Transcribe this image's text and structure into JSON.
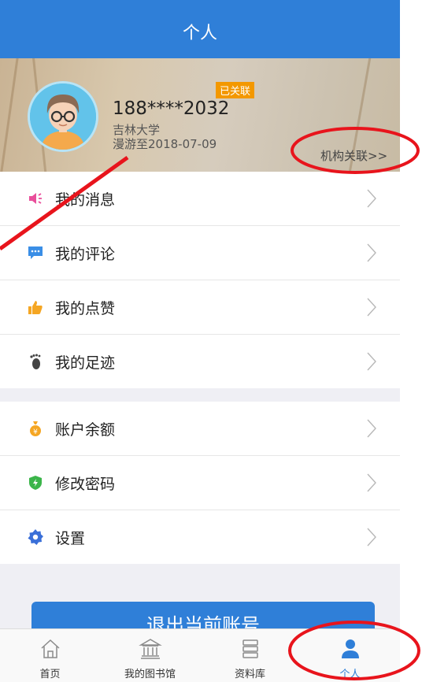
{
  "header": {
    "title": "个人"
  },
  "profile": {
    "phone": "188****2032",
    "school": "吉林大学",
    "roam": "漫游至2018-07-09",
    "badge": "已关联",
    "org_link": "机构关联>>"
  },
  "menu": {
    "group1": [
      {
        "label": "我的消息",
        "icon": "speaker-icon",
        "color": "#e94f9b"
      },
      {
        "label": "我的评论",
        "icon": "comment-icon",
        "color": "#3a8ee6"
      },
      {
        "label": "我的点赞",
        "icon": "thumbs-up-icon",
        "color": "#f5a623"
      },
      {
        "label": "我的足迹",
        "icon": "footprint-icon",
        "color": "#444444"
      }
    ],
    "group2": [
      {
        "label": "账户余额",
        "icon": "money-bag-icon",
        "color": "#f5a623"
      },
      {
        "label": "修改密码",
        "icon": "shield-icon",
        "color": "#3bb54a"
      },
      {
        "label": "设置",
        "icon": "gear-icon",
        "color": "#3a6fd8"
      }
    ]
  },
  "logout": {
    "label": "退出当前账号"
  },
  "tabs": [
    {
      "label": "首页",
      "icon": "home-icon"
    },
    {
      "label": "我的图书馆",
      "icon": "library-icon"
    },
    {
      "label": "资料库",
      "icon": "database-icon"
    },
    {
      "label": "个人",
      "icon": "person-icon",
      "active": true
    }
  ],
  "colors": {
    "primary": "#2f7fd8",
    "badge": "#f39800",
    "annotation": "#e8141c"
  }
}
